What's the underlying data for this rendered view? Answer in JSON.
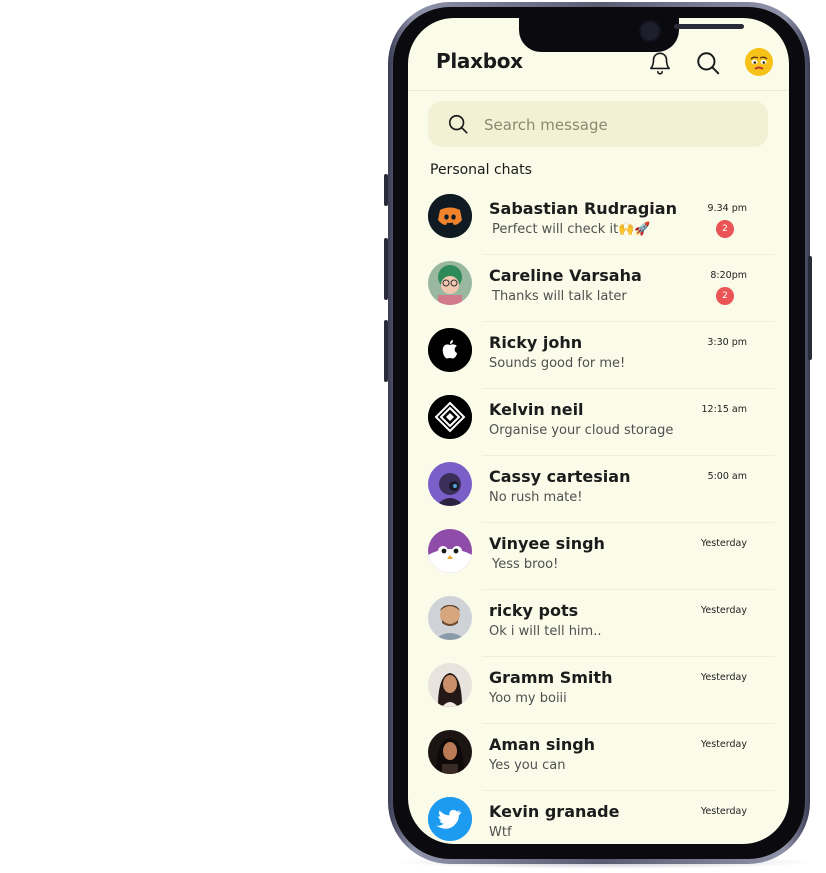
{
  "app": {
    "title": "Plaxbox"
  },
  "header": {
    "icons": [
      "bell-icon",
      "search-icon",
      "avatar-emoji"
    ]
  },
  "search": {
    "placeholder": "Search message"
  },
  "section": {
    "label": "Personal chats"
  },
  "chats": [
    {
      "name": "Sabastian Rudragian",
      "message": "Perfect will check it🙌🚀",
      "time": "9.34 pm",
      "unread": "2",
      "avatar": "discord-icon",
      "avatar_bg": "#0f1a22"
    },
    {
      "name": "Careline Varsaha",
      "message": "Thanks will talk later",
      "time": "8:20pm",
      "unread": "2",
      "avatar": "photo-woman-green-hair",
      "avatar_bg": "#7cc4a0"
    },
    {
      "name": "Ricky john",
      "message": "Sounds good for me!",
      "time": "3:30 pm",
      "unread": "",
      "avatar": "apple-icon",
      "avatar_bg": "#000000"
    },
    {
      "name": "Kelvin neil",
      "message": "Organise your cloud storage",
      "time": "12:15 am",
      "unread": "",
      "avatar": "diamond-logo-icon",
      "avatar_bg": "#000000"
    },
    {
      "name": "Cassy cartesian",
      "message": "No rush mate!",
      "time": "5:00 am",
      "unread": "",
      "avatar": "photo-purple",
      "avatar_bg": "#7b5fc9"
    },
    {
      "name": "Vinyee singh",
      "message": "Yess broo!",
      "time": "Yesterday",
      "unread": "",
      "avatar": "penguin-icon",
      "avatar_bg": "#8f4ca8"
    },
    {
      "name": "ricky pots",
      "message": "Ok i will tell him..",
      "time": "Yesterday",
      "unread": "",
      "avatar": "photo-man",
      "avatar_bg": "#c9a584"
    },
    {
      "name": "Gramm Smith",
      "message": "Yoo my boiii",
      "time": "Yesterday",
      "unread": "",
      "avatar": "photo-woman",
      "avatar_bg": "#3a2b2a"
    },
    {
      "name": "Aman singh",
      "message": "Yes you can",
      "time": "Yesterday",
      "unread": "",
      "avatar": "photo-woman-dark",
      "avatar_bg": "#2a1d1a"
    },
    {
      "name": "Kevin granade",
      "message": "Wtf",
      "time": "Yesterday",
      "unread": "",
      "avatar": "twitter-icon",
      "avatar_bg": "#1d9bf0"
    }
  ],
  "colors": {
    "screen_bg": "#fbfbea",
    "search_bg": "#f2f1d5",
    "badge": "#ea5455"
  }
}
